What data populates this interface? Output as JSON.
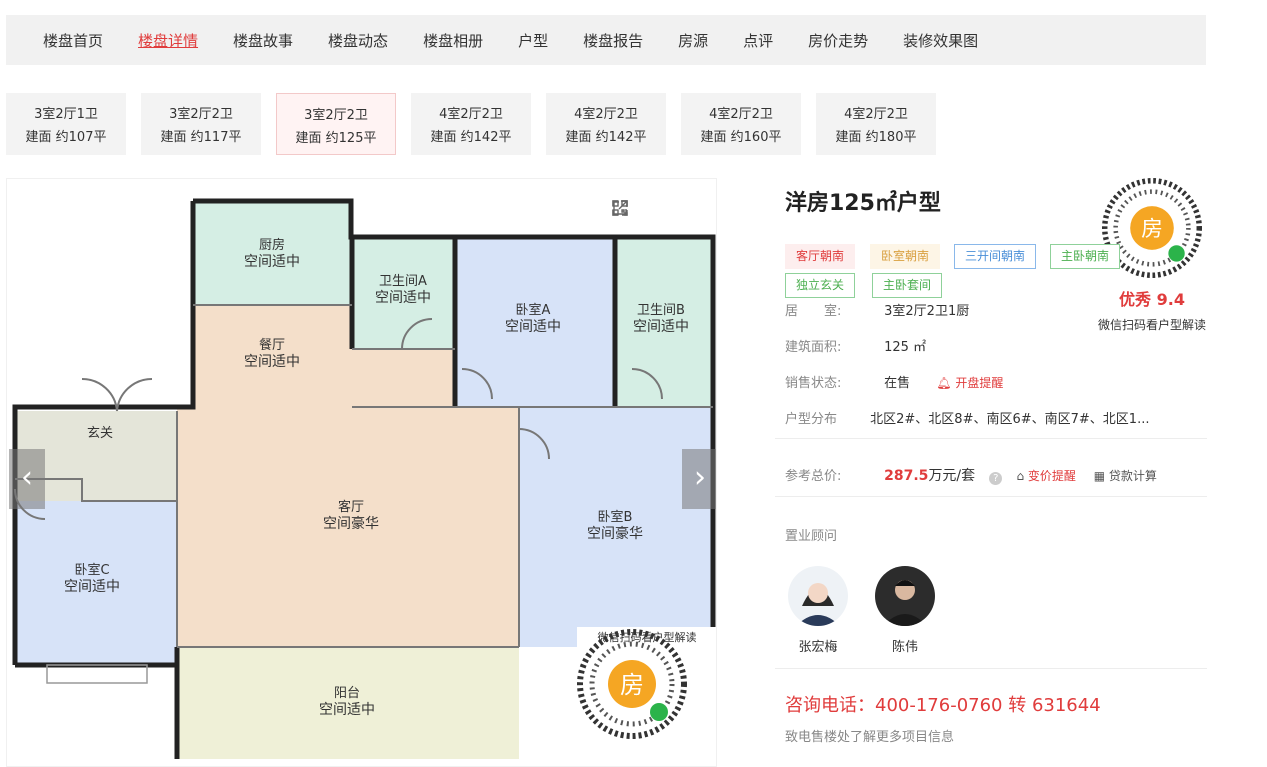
{
  "nav": {
    "items": [
      "楼盘首页",
      "楼盘详情",
      "楼盘故事",
      "楼盘动态",
      "楼盘相册",
      "户型",
      "楼盘报告",
      "房源",
      "点评",
      "房价走势",
      "装修效果图"
    ],
    "active_index": 1
  },
  "layout_tabs": [
    {
      "rooms": "3室2厅1卫",
      "area": "建面 约107平"
    },
    {
      "rooms": "3室2厅2卫",
      "area": "建面 约117平"
    },
    {
      "rooms": "3室2厅2卫",
      "area": "建面 约125平"
    },
    {
      "rooms": "4室2厅2卫",
      "area": "建面 约142平"
    },
    {
      "rooms": "4室2厅2卫",
      "area": "建面 约142平"
    },
    {
      "rooms": "4室2厅2卫",
      "area": "建面 约160平"
    },
    {
      "rooms": "4室2厅2卫",
      "area": "建面 约180平"
    }
  ],
  "active_tab_index": 2,
  "floorplan": {
    "rooms": [
      {
        "name": "厨房",
        "quality": "空间适中"
      },
      {
        "name": "卫生间A",
        "quality": "空间适中"
      },
      {
        "name": "卧室A",
        "quality": "空间适中"
      },
      {
        "name": "卫生间B",
        "quality": "空间适中"
      },
      {
        "name": "餐厅",
        "quality": "空间适中"
      },
      {
        "name": "玄关",
        "quality": ""
      },
      {
        "name": "客厅",
        "quality": "空间豪华"
      },
      {
        "name": "卧室B",
        "quality": "空间豪华"
      },
      {
        "name": "卧室C",
        "quality": "空间适中"
      },
      {
        "name": "阳台",
        "quality": "空间适中"
      }
    ],
    "qr_caption": "微信扫码看户型解读",
    "qr_center": "房",
    "icons": [
      "fullscreen-icon",
      "qrcode-icon",
      "external-link-icon"
    ]
  },
  "info": {
    "title": "洋房125㎡户型",
    "tags": [
      {
        "text": "客厅朝南",
        "color": "#e03c3c",
        "bg": "#fdeeee",
        "border": "#fdeeee"
      },
      {
        "text": "卧室朝南",
        "color": "#d9a040",
        "bg": "#fdf5e6",
        "border": "#fdf5e6"
      },
      {
        "text": "三开间朝南",
        "color": "#4a8fd8",
        "bg": "#ffffff",
        "border": "#8ab8ea"
      },
      {
        "text": "主卧朝南",
        "color": "#4caf50",
        "bg": "#ffffff",
        "border": "#8fd19a"
      },
      {
        "text": "独立玄关",
        "color": "#4caf50",
        "bg": "#ffffff",
        "border": "#8fd19a"
      },
      {
        "text": "主卧套间",
        "color": "#4caf50",
        "bg": "#ffffff",
        "border": "#8fd19a"
      }
    ],
    "rooms_label": "居　　室:",
    "rooms_value": "3室2厅2卫1厨",
    "area_label": "建筑面积:",
    "area_value": "125 ㎡",
    "status_label": "销售状态:",
    "status_value": "在售",
    "remind_label": "开盘提醒",
    "dist_label": "户型分布",
    "dist_value": "北区2#、北区8#、南区6#、南区7#、北区1...",
    "price_label": "参考总价:",
    "price_value": "287.5",
    "price_unit": "万元/套",
    "price_alert": "变价提醒",
    "loan_calc": "贷款计算",
    "score": "优秀 9.4",
    "score_caption": "微信扫码看户型解读",
    "advisor_title": "置业顾问",
    "advisors": [
      "张宏梅",
      "陈伟"
    ],
    "phone": "咨询电话：400-176-0760 转 631644",
    "phone_sub": "致电售楼处了解更多项目信息"
  }
}
